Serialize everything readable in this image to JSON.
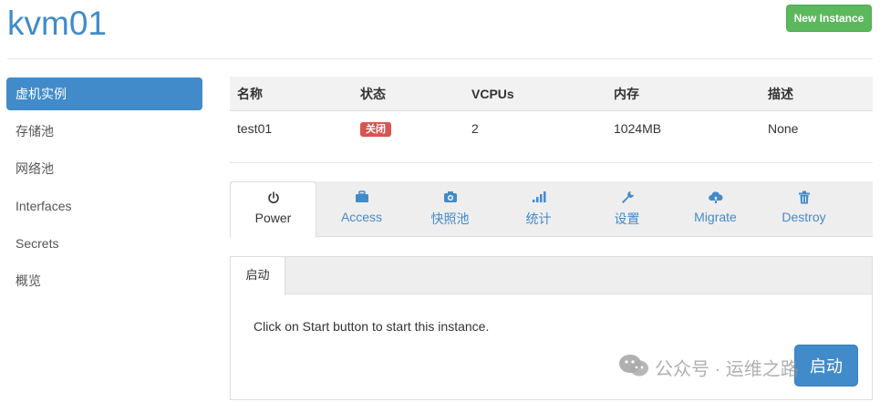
{
  "header": {
    "title": "kvm01",
    "new_instance_label": "New Instance"
  },
  "sidebar": {
    "items": [
      {
        "label": "虚机实例",
        "active": true
      },
      {
        "label": "存储池",
        "active": false
      },
      {
        "label": "网络池",
        "active": false
      },
      {
        "label": "Interfaces",
        "active": false
      },
      {
        "label": "Secrets",
        "active": false
      },
      {
        "label": "概览",
        "active": false
      }
    ]
  },
  "instances_table": {
    "columns": [
      "名称",
      "状态",
      "VCPUs",
      "内存",
      "描述"
    ],
    "rows": [
      {
        "name": "test01",
        "status": "关闭",
        "vcpus": "2",
        "memory": "1024MB",
        "description": "None"
      }
    ],
    "status_color": "#d9534f"
  },
  "tabs": [
    {
      "label": "Power",
      "icon": "power-icon",
      "active": true
    },
    {
      "label": "Access",
      "icon": "briefcase-icon",
      "active": false
    },
    {
      "label": "快照池",
      "icon": "camera-icon",
      "active": false
    },
    {
      "label": "统计",
      "icon": "signal-bars-icon",
      "active": false
    },
    {
      "label": "设置",
      "icon": "wrench-icon",
      "active": false
    },
    {
      "label": "Migrate",
      "icon": "cloud-upload-icon",
      "active": false
    },
    {
      "label": "Destroy",
      "icon": "trash-icon",
      "active": false
    }
  ],
  "power_panel": {
    "subtab_label": "启动",
    "instruction": "Click on Start button to start this instance.",
    "start_button_label": "启动"
  },
  "watermark": {
    "text": "公众号 · 运维之路"
  },
  "colors": {
    "primary": "#428bca",
    "success": "#5cb85c",
    "danger": "#d9534f"
  }
}
